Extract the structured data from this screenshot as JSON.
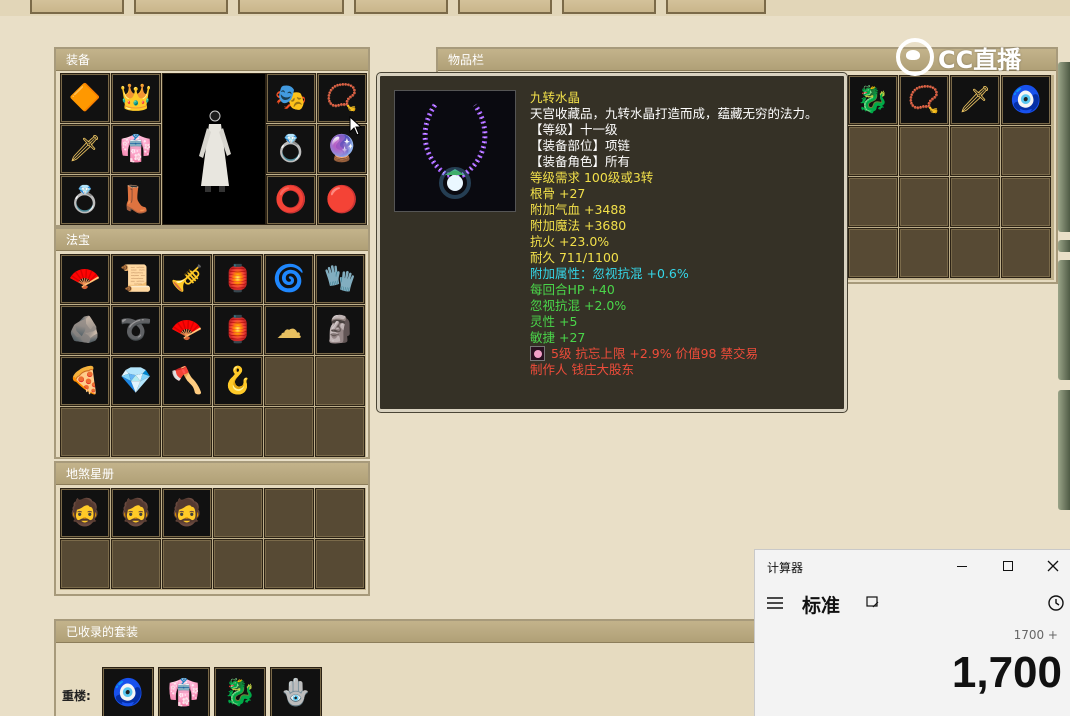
{
  "top_tabs": [
    "",
    "",
    "",
    "",
    "",
    "",
    "",
    ""
  ],
  "equipment": {
    "title": "装备",
    "left_slots": [
      "shoulder-icon",
      "crown-icon",
      "sword-icon",
      "robe-icon",
      "ring-icon",
      "boots-icon"
    ],
    "right_slots": [
      "helmet-icon",
      "necklace-icon",
      "ring-icon",
      "orb-icon",
      "bracelet-icon",
      "amulet-icon"
    ]
  },
  "fabao": {
    "title": "法宝",
    "items": [
      "fan-icon",
      "scroll-icon",
      "flute-icon",
      "lantern-icon",
      "vortex-icon",
      "gauntlet-icon",
      "plate-icon",
      "whip-icon",
      "fan-icon",
      "lamp-icon",
      "cloud-icon",
      "stone-icon",
      "pillow-icon",
      "crystal-icon",
      "axe-icon",
      "hook-icon"
    ]
  },
  "star_book": {
    "title": "地煞星册",
    "cards": [
      "warrior-portrait",
      "warrior-portrait",
      "warrior-portrait"
    ]
  },
  "inventory": {
    "title": "物品栏",
    "visible_items": [
      "dragon-icon",
      "necklace-icon",
      "sword-icon",
      "pendant-icon"
    ]
  },
  "tooltip": {
    "name": "九转水晶",
    "description": "天宫收藏品，九转水晶打造而成，蕴藏无穷的法力。",
    "lines_white": [
      "【等级】十一级",
      "【装备部位】项链",
      "【装备角色】所有"
    ],
    "requirement": "等级需求 100级或3转",
    "base_stats": [
      "根骨 +27",
      "附加气血 +3488",
      "附加魔法 +3680",
      "抗火 +23.0%"
    ],
    "durability": "耐久 711/1100",
    "extra_attr": "附加属性：忽视抗混 +0.6%",
    "green_stats": [
      "每回合HP +40",
      "忽视抗混 +2.0%",
      "灵性 +5",
      "敏捷 +27"
    ],
    "gem_line": "5级 抗忘上限 +2.9% 价值98 禁交易",
    "maker": "制作人 钱庄大股东"
  },
  "collection": {
    "title": "已收录的套装",
    "row_label": "重楼:",
    "items": [
      "pendant-icon",
      "robe-icon",
      "dragon-icon",
      "bracelet-icon"
    ]
  },
  "calculator": {
    "app_title": "计算器",
    "mode": "标准",
    "expression": "1700 +",
    "display": "1,700"
  },
  "watermark": {
    "text": "CC直播"
  }
}
